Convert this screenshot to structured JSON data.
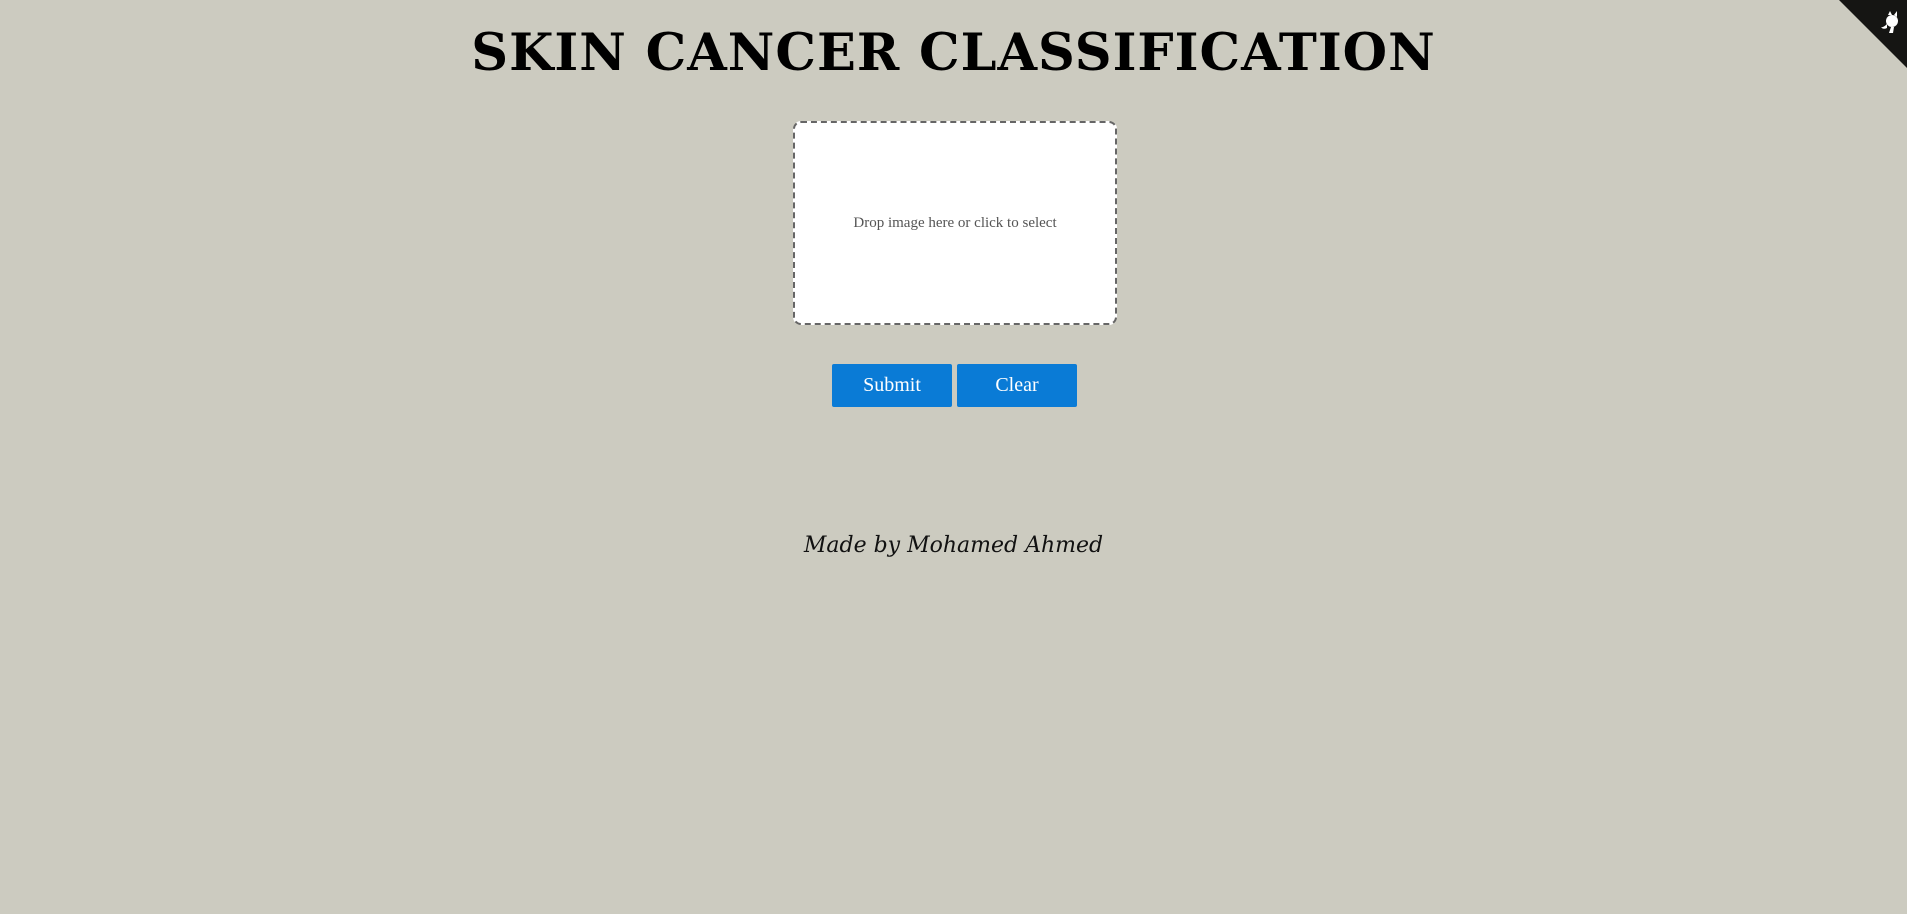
{
  "header": {
    "title": "SKIN CANCER CLASSIFICATION"
  },
  "upload": {
    "prompt": "Drop image here or click to select"
  },
  "actions": {
    "submit_label": "Submit",
    "clear_label": "Clear"
  },
  "footer": {
    "credit": "Made by Mohamed Ahmed"
  },
  "corner_icon": "github-octocat-icon",
  "colors": {
    "background": "#cccbc0",
    "button": "#0a7bd6",
    "dropzone": "#ffffff"
  }
}
